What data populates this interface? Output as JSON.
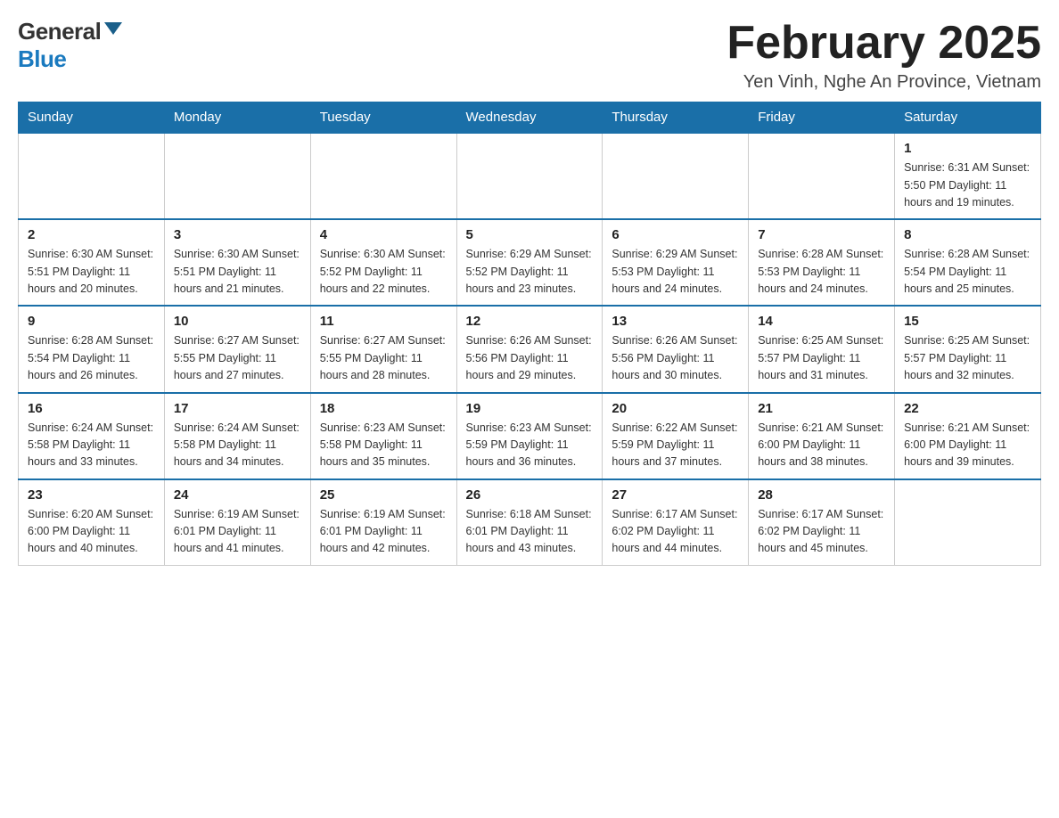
{
  "logo": {
    "general": "General",
    "blue": "Blue"
  },
  "header": {
    "title": "February 2025",
    "subtitle": "Yen Vinh, Nghe An Province, Vietnam"
  },
  "weekdays": [
    "Sunday",
    "Monday",
    "Tuesday",
    "Wednesday",
    "Thursday",
    "Friday",
    "Saturday"
  ],
  "weeks": [
    [
      {
        "day": "",
        "info": ""
      },
      {
        "day": "",
        "info": ""
      },
      {
        "day": "",
        "info": ""
      },
      {
        "day": "",
        "info": ""
      },
      {
        "day": "",
        "info": ""
      },
      {
        "day": "",
        "info": ""
      },
      {
        "day": "1",
        "info": "Sunrise: 6:31 AM\nSunset: 5:50 PM\nDaylight: 11 hours\nand 19 minutes."
      }
    ],
    [
      {
        "day": "2",
        "info": "Sunrise: 6:30 AM\nSunset: 5:51 PM\nDaylight: 11 hours\nand 20 minutes."
      },
      {
        "day": "3",
        "info": "Sunrise: 6:30 AM\nSunset: 5:51 PM\nDaylight: 11 hours\nand 21 minutes."
      },
      {
        "day": "4",
        "info": "Sunrise: 6:30 AM\nSunset: 5:52 PM\nDaylight: 11 hours\nand 22 minutes."
      },
      {
        "day": "5",
        "info": "Sunrise: 6:29 AM\nSunset: 5:52 PM\nDaylight: 11 hours\nand 23 minutes."
      },
      {
        "day": "6",
        "info": "Sunrise: 6:29 AM\nSunset: 5:53 PM\nDaylight: 11 hours\nand 24 minutes."
      },
      {
        "day": "7",
        "info": "Sunrise: 6:28 AM\nSunset: 5:53 PM\nDaylight: 11 hours\nand 24 minutes."
      },
      {
        "day": "8",
        "info": "Sunrise: 6:28 AM\nSunset: 5:54 PM\nDaylight: 11 hours\nand 25 minutes."
      }
    ],
    [
      {
        "day": "9",
        "info": "Sunrise: 6:28 AM\nSunset: 5:54 PM\nDaylight: 11 hours\nand 26 minutes."
      },
      {
        "day": "10",
        "info": "Sunrise: 6:27 AM\nSunset: 5:55 PM\nDaylight: 11 hours\nand 27 minutes."
      },
      {
        "day": "11",
        "info": "Sunrise: 6:27 AM\nSunset: 5:55 PM\nDaylight: 11 hours\nand 28 minutes."
      },
      {
        "day": "12",
        "info": "Sunrise: 6:26 AM\nSunset: 5:56 PM\nDaylight: 11 hours\nand 29 minutes."
      },
      {
        "day": "13",
        "info": "Sunrise: 6:26 AM\nSunset: 5:56 PM\nDaylight: 11 hours\nand 30 minutes."
      },
      {
        "day": "14",
        "info": "Sunrise: 6:25 AM\nSunset: 5:57 PM\nDaylight: 11 hours\nand 31 minutes."
      },
      {
        "day": "15",
        "info": "Sunrise: 6:25 AM\nSunset: 5:57 PM\nDaylight: 11 hours\nand 32 minutes."
      }
    ],
    [
      {
        "day": "16",
        "info": "Sunrise: 6:24 AM\nSunset: 5:58 PM\nDaylight: 11 hours\nand 33 minutes."
      },
      {
        "day": "17",
        "info": "Sunrise: 6:24 AM\nSunset: 5:58 PM\nDaylight: 11 hours\nand 34 minutes."
      },
      {
        "day": "18",
        "info": "Sunrise: 6:23 AM\nSunset: 5:58 PM\nDaylight: 11 hours\nand 35 minutes."
      },
      {
        "day": "19",
        "info": "Sunrise: 6:23 AM\nSunset: 5:59 PM\nDaylight: 11 hours\nand 36 minutes."
      },
      {
        "day": "20",
        "info": "Sunrise: 6:22 AM\nSunset: 5:59 PM\nDaylight: 11 hours\nand 37 minutes."
      },
      {
        "day": "21",
        "info": "Sunrise: 6:21 AM\nSunset: 6:00 PM\nDaylight: 11 hours\nand 38 minutes."
      },
      {
        "day": "22",
        "info": "Sunrise: 6:21 AM\nSunset: 6:00 PM\nDaylight: 11 hours\nand 39 minutes."
      }
    ],
    [
      {
        "day": "23",
        "info": "Sunrise: 6:20 AM\nSunset: 6:00 PM\nDaylight: 11 hours\nand 40 minutes."
      },
      {
        "day": "24",
        "info": "Sunrise: 6:19 AM\nSunset: 6:01 PM\nDaylight: 11 hours\nand 41 minutes."
      },
      {
        "day": "25",
        "info": "Sunrise: 6:19 AM\nSunset: 6:01 PM\nDaylight: 11 hours\nand 42 minutes."
      },
      {
        "day": "26",
        "info": "Sunrise: 6:18 AM\nSunset: 6:01 PM\nDaylight: 11 hours\nand 43 minutes."
      },
      {
        "day": "27",
        "info": "Sunrise: 6:17 AM\nSunset: 6:02 PM\nDaylight: 11 hours\nand 44 minutes."
      },
      {
        "day": "28",
        "info": "Sunrise: 6:17 AM\nSunset: 6:02 PM\nDaylight: 11 hours\nand 45 minutes."
      },
      {
        "day": "",
        "info": ""
      }
    ]
  ]
}
